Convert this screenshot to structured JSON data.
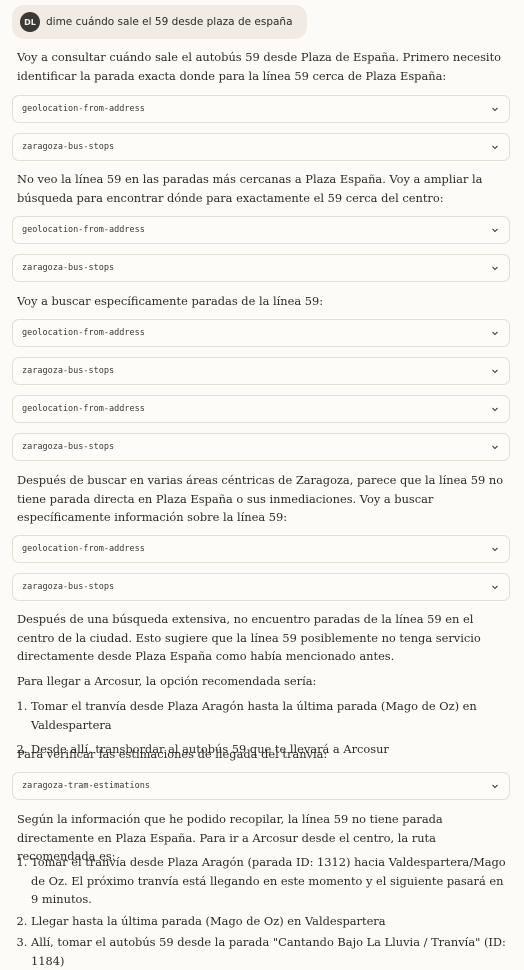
{
  "user": {
    "initials": "DL",
    "message": "dime cuándo sale el 59 desde plaza de españa"
  },
  "assistant": {
    "p1": "Voy a consultar cuándo sale el autobús 59 desde Plaza de España. Primero necesito identificar la parada exacta donde para la línea 59 cerca de Plaza España:",
    "p2": "No veo la línea 59 en las paradas más cercanas a Plaza España. Voy a ampliar la búsqueda para encontrar dónde para exactamente el 59 cerca del centro:",
    "p3": "Voy a buscar específicamente paradas de la línea 59:",
    "p4": "Después de buscar en varias áreas céntricas de Zaragoza, parece que la línea 59 no tiene parada directa en Plaza España o sus inmediaciones. Voy a buscar específicamente información sobre la línea 59:",
    "p5": "Después de una búsqueda extensiva, no encuentro paradas de la línea 59 en el centro de la ciudad. Esto sugiere que la línea 59 posiblemente no tenga servicio directamente desde Plaza España como había mencionado antes.",
    "p6": "Para llegar a Arcosur, la opción recomendada sería:",
    "list1": [
      "Tomar el tranvía desde Plaza Aragón hasta la última parada (Mago de Oz) en Valdespartera",
      "Desde allí, transbordar al autobús 59 que te llevará a Arcosur"
    ],
    "p7": "Para verificar las estimaciones de llegada del tranvía:",
    "p8": "Según la información que he podido recopilar, la línea 59 no tiene parada directamente en Plaza España. Para ir a Arcosur desde el centro, la ruta recomendada es:",
    "list2": [
      "Tomar el tranvía desde Plaza Aragón (parada ID: 1312) hacia Valdespartera/Mago de Oz. El próximo tranvía está llegando en este momento y el siguiente pasará en 9 minutos.",
      "Llegar hasta la última parada (Mago de Oz) en Valdespartera",
      "Allí, tomar el autobús 59 desde la parada \"Cantando Bajo La Lluvia / Tranvía\" (ID: 1184)"
    ]
  },
  "tools": {
    "geo": "geolocation-from-address",
    "bus": "zaragoza-bus-stops",
    "tram": "zaragoza-tram-estimations"
  }
}
